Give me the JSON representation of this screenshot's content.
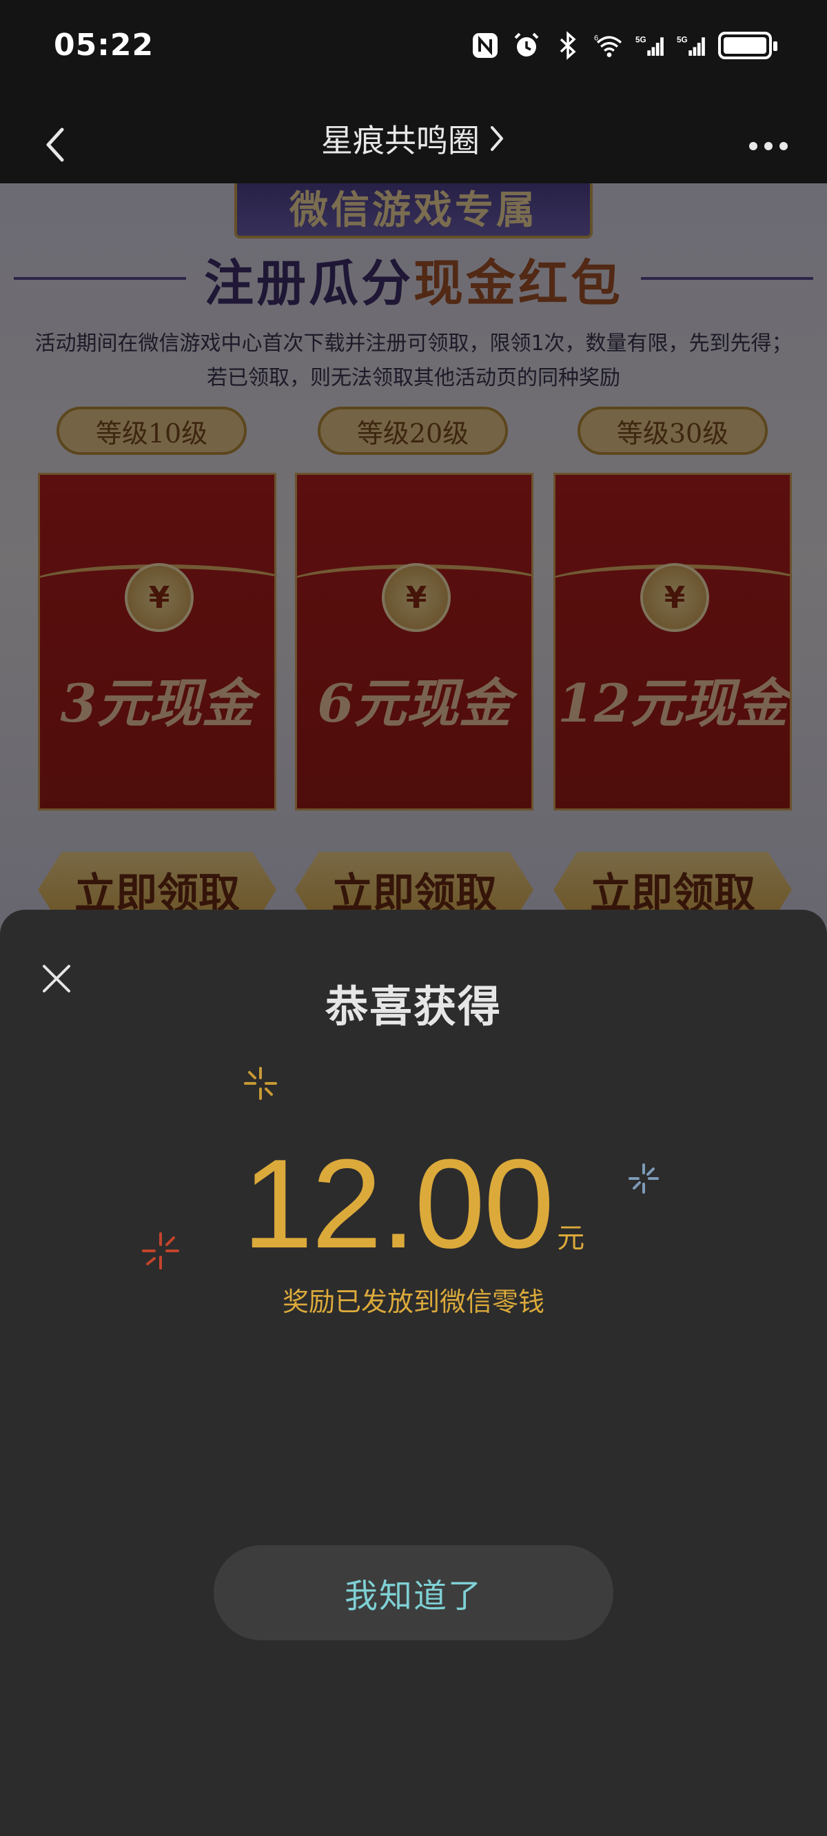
{
  "status_bar": {
    "time": "05:22",
    "icons": [
      "nfc-icon",
      "alarm-icon",
      "bluetooth-icon",
      "wifi-6-icon",
      "signal-5g-icon",
      "signal-5g-icon",
      "battery-icon"
    ]
  },
  "nav": {
    "title": "星痕共鸣圈",
    "back_icon": "chevron-left-icon",
    "title_arrow_icon": "chevron-right-icon",
    "more_icon": "more-dots-icon"
  },
  "promo": {
    "banner": "微信游戏专属",
    "headline_part1": "注册瓜分",
    "headline_part2": "现金红包",
    "desc_line1": "活动期间在微信游戏中心首次下载并注册可领取，限领1次，数量有限，先到先得；",
    "desc_line2": "若已领取，则无法领取其他活动页的同种奖励",
    "tiers": [
      {
        "level": "等级10级",
        "amount": "3元现金",
        "button": "立即领取"
      },
      {
        "level": "等级20级",
        "amount": "6元现金",
        "button": "立即领取"
      },
      {
        "level": "等级30级",
        "amount": "12元现金",
        "button": "立即领取"
      }
    ],
    "coin_symbol": "¥"
  },
  "sheet": {
    "title": "恭喜获得",
    "amount": "12.00",
    "unit": "元",
    "note": "奖励已发放到微信零钱",
    "button": "我知道了",
    "close_icon": "close-icon"
  },
  "colors": {
    "gold": "#dcaa3b",
    "teal_button_text": "#7fd0d4",
    "sheet_bg": "#2c2c2c"
  }
}
